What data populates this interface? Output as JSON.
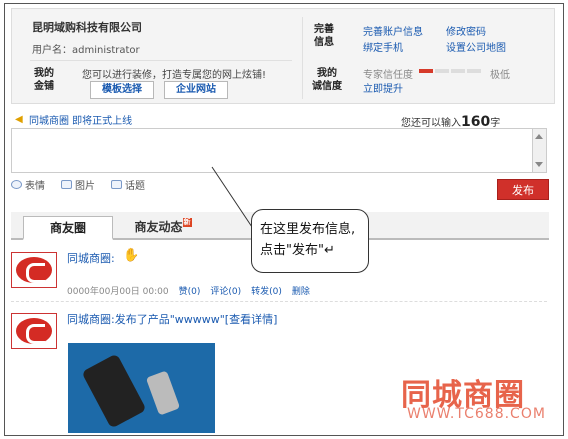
{
  "company": {
    "name": "昆明域购科技有限公司",
    "user_label": "用户名：",
    "username": "administrator"
  },
  "shop": {
    "label_line1": "我的",
    "label_line2": "金铺",
    "desc": "您可以进行装修，打造专属您的网上炫铺!",
    "template_btn": "模板选择",
    "site_btn": "企业网站"
  },
  "info": {
    "label_line1": "完善",
    "label_line2": "信息",
    "links": [
      "完善账户信息",
      "修改密码",
      "绑定手机",
      "设置公司地图"
    ]
  },
  "credit": {
    "label_line1": "我的",
    "label_line2": "诚信度",
    "text": "专家信任度",
    "level": 1,
    "max": 4,
    "ext": "极低",
    "improve_link": "立即提升"
  },
  "notice": {
    "text": "同城商圈 即将正式上线"
  },
  "counter": {
    "prefix": "您还可以输入",
    "number": "160",
    "suffix": "字"
  },
  "toolbar": {
    "emoji": "表情",
    "image": "图片",
    "topic": "话题",
    "publish": "发布"
  },
  "tabs": {
    "circle": "商友圈",
    "dynamics": "商友动态",
    "new_badge": "新"
  },
  "posts": [
    {
      "title": "同城商圈:",
      "date": "0000年00月00日 00:00",
      "actions": [
        "赞(0)",
        "评论(0)",
        "转发(0)",
        "删除"
      ]
    },
    {
      "title": "同城商圈:发布了产品\"wwwww\"[查看详情]"
    }
  ],
  "callout": {
    "text": "在这里发布信息,点击\"发布\"↵"
  },
  "watermark": {
    "logo": "同城商圈",
    "url": "WWW.TC688.COM"
  },
  "colors": {
    "accent": "#1a5ab0",
    "publish": "#d0302a",
    "brand": "#d42b24"
  }
}
